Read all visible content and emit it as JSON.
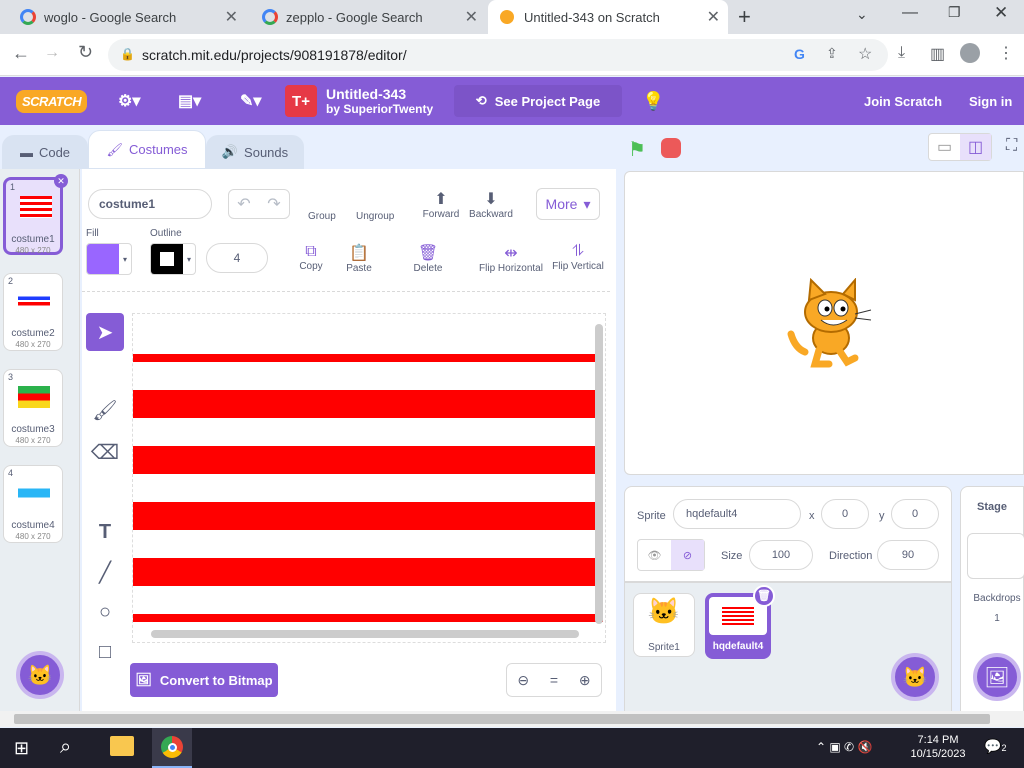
{
  "browser": {
    "tabs": [
      {
        "title": "woglo - Google Search"
      },
      {
        "title": "zepplo - Google Search"
      },
      {
        "title": "Untitled-343 on Scratch"
      }
    ],
    "url": "scratch.mit.edu/projects/908191878/editor/"
  },
  "menubar": {
    "logo": "SCRATCH",
    "project_title": "Untitled-343",
    "project_author": "by SuperiorTwenty",
    "see_project": "See Project Page",
    "join": "Join Scratch",
    "signin": "Sign in"
  },
  "editor_tabs": {
    "code": "Code",
    "costumes": "Costumes",
    "sounds": "Sounds"
  },
  "costumes": [
    {
      "num": "1",
      "name": "costume1",
      "size": "480 x 270"
    },
    {
      "num": "2",
      "name": "costume2",
      "size": "480 x 270"
    },
    {
      "num": "3",
      "name": "costume3",
      "size": "480 x 270"
    },
    {
      "num": "4",
      "name": "costume4",
      "size": "480 x 270"
    }
  ],
  "paint": {
    "costume_name": "costume1",
    "group": "Group",
    "ungroup": "Ungroup",
    "forward": "Forward",
    "backward": "Backward",
    "more": "More",
    "fill_label": "Fill",
    "outline_label": "Outline",
    "outline_width": "4",
    "copy": "Copy",
    "paste": "Paste",
    "delete": "Delete",
    "flip_h": "Flip Horizontal",
    "flip_v": "Flip Vertical",
    "convert": "Convert to Bitmap",
    "zoom_reset": "="
  },
  "colors": {
    "fill": "#9966ff",
    "outline": "#000000",
    "accent": "#855cd6",
    "stripe": "#ff0000"
  },
  "sprite": {
    "label": "Sprite",
    "name": "hqdefault4",
    "x_label": "x",
    "x": "0",
    "y_label": "y",
    "y": "0",
    "size_label": "Size",
    "size": "100",
    "direction_label": "Direction",
    "direction": "90"
  },
  "sprites": [
    {
      "name": "Sprite1"
    },
    {
      "name": "hqdefault4"
    }
  ],
  "stage_panel": {
    "title": "Stage",
    "backdrops_label": "Backdrops",
    "backdrops_count": "1"
  },
  "taskbar": {
    "time": "7:14 PM",
    "date": "10/15/2023",
    "notif": "2"
  }
}
